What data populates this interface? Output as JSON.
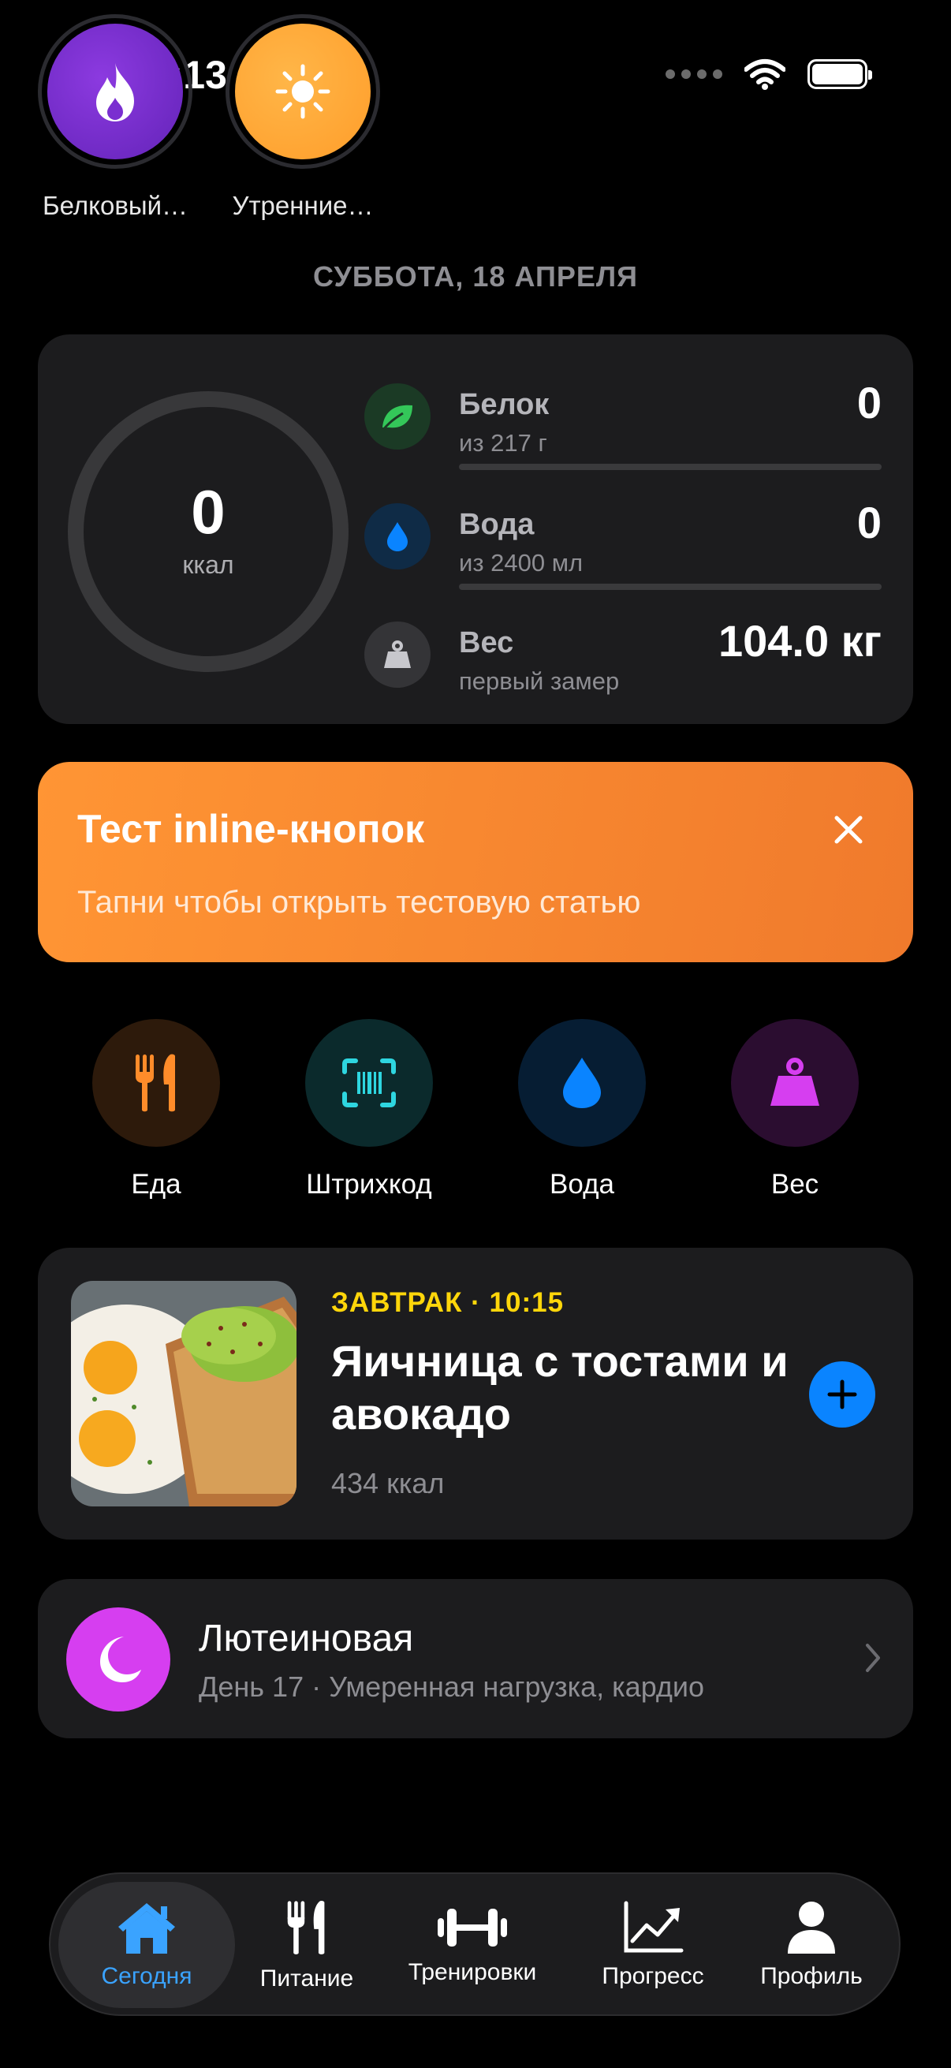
{
  "status_bar": {
    "time": "10:13"
  },
  "stories": [
    {
      "label": "Белковый…",
      "icon": "flame-icon",
      "color": "#7a2fd0"
    },
    {
      "label": "Утренние…",
      "icon": "sun-icon",
      "color": "#ffa42e"
    }
  ],
  "date": "СУББОТА, 18 АПРЕЛЯ",
  "summary": {
    "calories": {
      "value": "0",
      "unit": "ккал"
    },
    "protein": {
      "title": "Белок",
      "subtitle": "из 217 г",
      "value": "0",
      "progress": 0
    },
    "water": {
      "title": "Вода",
      "subtitle": "из 2400 мл",
      "value": "0",
      "progress": 0
    },
    "weight": {
      "title": "Вес",
      "subtitle": "первый замер",
      "value": "104.0 кг"
    }
  },
  "banner": {
    "title": "Тест inline-кнопок",
    "text": "Тапни чтобы открыть тестовую статью"
  },
  "quick_actions": [
    {
      "label": "Еда",
      "icon": "fork-knife-icon"
    },
    {
      "label": "Штрихкод",
      "icon": "barcode-icon"
    },
    {
      "label": "Вода",
      "icon": "water-drop-icon"
    },
    {
      "label": "Вес",
      "icon": "weight-icon"
    }
  ],
  "meal": {
    "tag": "ЗАВТРАК · 10:15",
    "name": "Яичница с тостами и авокадо",
    "kcal": "434 ккал"
  },
  "cycle": {
    "title": "Лютеиновая",
    "subtitle": "День 17 · Умеренная нагрузка, кардио"
  },
  "tabs": [
    {
      "label": "Сегодня",
      "icon": "home-icon",
      "active": true
    },
    {
      "label": "Питание",
      "icon": "fork-knife-icon",
      "active": false
    },
    {
      "label": "Тренировки",
      "icon": "dumbbell-icon",
      "active": false
    },
    {
      "label": "Прогресс",
      "icon": "chart-icon",
      "active": false
    },
    {
      "label": "Профиль",
      "icon": "person-icon",
      "active": false
    }
  ],
  "colors": {
    "accent_blue": "#0a84ff",
    "banner_orange": "#f5872f",
    "meal_tag_yellow": "#ffd60a",
    "cycle_purple": "#d63ef0"
  }
}
